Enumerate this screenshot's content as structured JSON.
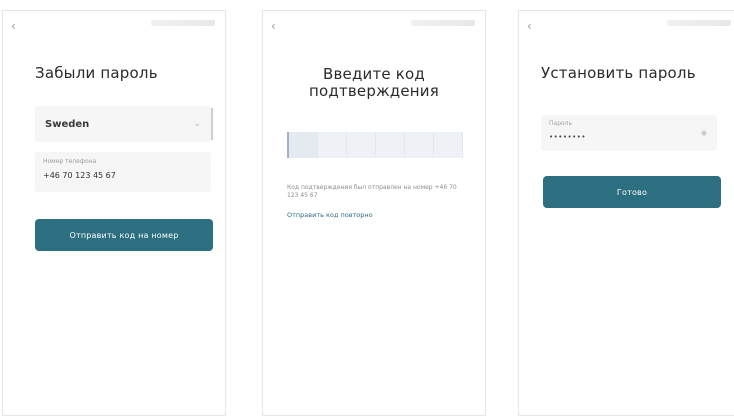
{
  "screens": {
    "forgot": {
      "back_icon": "‹",
      "title": "Забыли пароль",
      "country_select": {
        "value": "Sweden",
        "chevron": "⌄"
      },
      "phone_field": {
        "label": "Номер телефона",
        "value": "+46 70 123 45 67"
      },
      "submit_label": "Отправить код на номер"
    },
    "code": {
      "back_icon": "‹",
      "title": "Введите код подтверждения",
      "code_cells": 6,
      "hint": "Код подтверждения был отправлен на номер +46 70 123 45 67",
      "resend_label": "Отправить код повторно"
    },
    "set_password": {
      "back_icon": "‹",
      "title": "Установить пароль",
      "password_field": {
        "label": "Пароль",
        "value": "••••••••",
        "eye_icon": "◉"
      },
      "submit_label": "Готово"
    }
  },
  "colors": {
    "primary": "#2b6f80",
    "field_bg": "#f6f6f6",
    "code_bg": "#eef1f5",
    "text": "#2b2b2b"
  }
}
